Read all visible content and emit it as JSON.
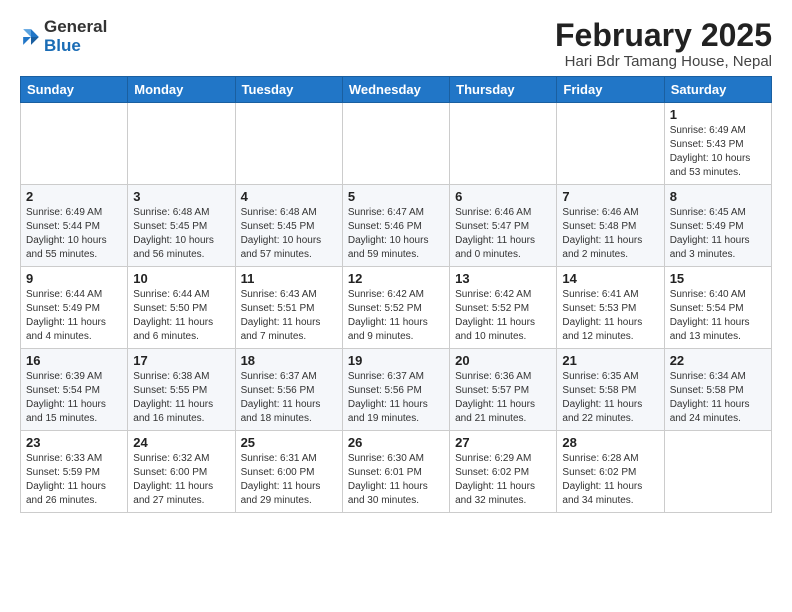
{
  "header": {
    "logo_general": "General",
    "logo_blue": "Blue",
    "title": "February 2025",
    "subtitle": "Hari Bdr Tamang House, Nepal"
  },
  "weekdays": [
    "Sunday",
    "Monday",
    "Tuesday",
    "Wednesday",
    "Thursday",
    "Friday",
    "Saturday"
  ],
  "weeks": [
    [
      {
        "day": "",
        "info": ""
      },
      {
        "day": "",
        "info": ""
      },
      {
        "day": "",
        "info": ""
      },
      {
        "day": "",
        "info": ""
      },
      {
        "day": "",
        "info": ""
      },
      {
        "day": "",
        "info": ""
      },
      {
        "day": "1",
        "info": "Sunrise: 6:49 AM\nSunset: 5:43 PM\nDaylight: 10 hours and 53 minutes."
      }
    ],
    [
      {
        "day": "2",
        "info": "Sunrise: 6:49 AM\nSunset: 5:44 PM\nDaylight: 10 hours and 55 minutes."
      },
      {
        "day": "3",
        "info": "Sunrise: 6:48 AM\nSunset: 5:45 PM\nDaylight: 10 hours and 56 minutes."
      },
      {
        "day": "4",
        "info": "Sunrise: 6:48 AM\nSunset: 5:45 PM\nDaylight: 10 hours and 57 minutes."
      },
      {
        "day": "5",
        "info": "Sunrise: 6:47 AM\nSunset: 5:46 PM\nDaylight: 10 hours and 59 minutes."
      },
      {
        "day": "6",
        "info": "Sunrise: 6:46 AM\nSunset: 5:47 PM\nDaylight: 11 hours and 0 minutes."
      },
      {
        "day": "7",
        "info": "Sunrise: 6:46 AM\nSunset: 5:48 PM\nDaylight: 11 hours and 2 minutes."
      },
      {
        "day": "8",
        "info": "Sunrise: 6:45 AM\nSunset: 5:49 PM\nDaylight: 11 hours and 3 minutes."
      }
    ],
    [
      {
        "day": "9",
        "info": "Sunrise: 6:44 AM\nSunset: 5:49 PM\nDaylight: 11 hours and 4 minutes."
      },
      {
        "day": "10",
        "info": "Sunrise: 6:44 AM\nSunset: 5:50 PM\nDaylight: 11 hours and 6 minutes."
      },
      {
        "day": "11",
        "info": "Sunrise: 6:43 AM\nSunset: 5:51 PM\nDaylight: 11 hours and 7 minutes."
      },
      {
        "day": "12",
        "info": "Sunrise: 6:42 AM\nSunset: 5:52 PM\nDaylight: 11 hours and 9 minutes."
      },
      {
        "day": "13",
        "info": "Sunrise: 6:42 AM\nSunset: 5:52 PM\nDaylight: 11 hours and 10 minutes."
      },
      {
        "day": "14",
        "info": "Sunrise: 6:41 AM\nSunset: 5:53 PM\nDaylight: 11 hours and 12 minutes."
      },
      {
        "day": "15",
        "info": "Sunrise: 6:40 AM\nSunset: 5:54 PM\nDaylight: 11 hours and 13 minutes."
      }
    ],
    [
      {
        "day": "16",
        "info": "Sunrise: 6:39 AM\nSunset: 5:54 PM\nDaylight: 11 hours and 15 minutes."
      },
      {
        "day": "17",
        "info": "Sunrise: 6:38 AM\nSunset: 5:55 PM\nDaylight: 11 hours and 16 minutes."
      },
      {
        "day": "18",
        "info": "Sunrise: 6:37 AM\nSunset: 5:56 PM\nDaylight: 11 hours and 18 minutes."
      },
      {
        "day": "19",
        "info": "Sunrise: 6:37 AM\nSunset: 5:56 PM\nDaylight: 11 hours and 19 minutes."
      },
      {
        "day": "20",
        "info": "Sunrise: 6:36 AM\nSunset: 5:57 PM\nDaylight: 11 hours and 21 minutes."
      },
      {
        "day": "21",
        "info": "Sunrise: 6:35 AM\nSunset: 5:58 PM\nDaylight: 11 hours and 22 minutes."
      },
      {
        "day": "22",
        "info": "Sunrise: 6:34 AM\nSunset: 5:58 PM\nDaylight: 11 hours and 24 minutes."
      }
    ],
    [
      {
        "day": "23",
        "info": "Sunrise: 6:33 AM\nSunset: 5:59 PM\nDaylight: 11 hours and 26 minutes."
      },
      {
        "day": "24",
        "info": "Sunrise: 6:32 AM\nSunset: 6:00 PM\nDaylight: 11 hours and 27 minutes."
      },
      {
        "day": "25",
        "info": "Sunrise: 6:31 AM\nSunset: 6:00 PM\nDaylight: 11 hours and 29 minutes."
      },
      {
        "day": "26",
        "info": "Sunrise: 6:30 AM\nSunset: 6:01 PM\nDaylight: 11 hours and 30 minutes."
      },
      {
        "day": "27",
        "info": "Sunrise: 6:29 AM\nSunset: 6:02 PM\nDaylight: 11 hours and 32 minutes."
      },
      {
        "day": "28",
        "info": "Sunrise: 6:28 AM\nSunset: 6:02 PM\nDaylight: 11 hours and 34 minutes."
      },
      {
        "day": "",
        "info": ""
      }
    ]
  ]
}
